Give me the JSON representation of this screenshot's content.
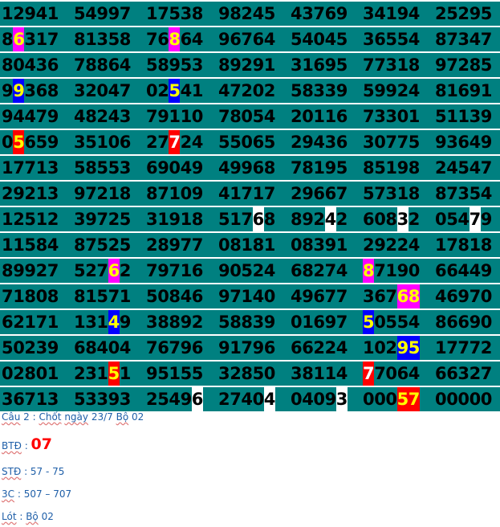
{
  "grid": {
    "rows": [
      [
        "12941",
        "54997",
        "17538",
        "98245",
        "43769",
        "34194",
        "25295"
      ],
      [
        "86317",
        "81358",
        "76864",
        "96764",
        "54045",
        "36554",
        "87347"
      ],
      [
        "80436",
        "78864",
        "58953",
        "89291",
        "31695",
        "77318",
        "97285"
      ],
      [
        "99368",
        "32047",
        "02541",
        "47202",
        "58339",
        "59924",
        "81691"
      ],
      [
        "94479",
        "48243",
        "79110",
        "78054",
        "20116",
        "73301",
        "51139"
      ],
      [
        "05659",
        "35106",
        "27724",
        "55065",
        "29436",
        "30775",
        "93649"
      ],
      [
        "17713",
        "58553",
        "69049",
        "49968",
        "78195",
        "85198",
        "24547"
      ],
      [
        "29213",
        "97218",
        "87109",
        "41717",
        "29667",
        "57318",
        "87354"
      ],
      [
        "12512",
        "39725",
        "31918",
        "51768",
        "89242",
        "60832",
        "05479"
      ],
      [
        "11584",
        "87525",
        "28977",
        "08181",
        "08391",
        "29224",
        "17818"
      ],
      [
        "89927",
        "52762",
        "79716",
        "90524",
        "68274",
        "87190",
        "66449"
      ],
      [
        "71808",
        "81571",
        "50846",
        "97140",
        "49677",
        "36768",
        "46970"
      ],
      [
        "62171",
        "13149",
        "38892",
        "58839",
        "01697",
        "50554",
        "86690"
      ],
      [
        "50239",
        "68404",
        "76796",
        "91796",
        "66224",
        "10295",
        "17772"
      ],
      [
        "02801",
        "23151",
        "95155",
        "32850",
        "38114",
        "77064",
        "66327"
      ],
      [
        "36713",
        "53393",
        "25496",
        "27404",
        "04093",
        "00057",
        "00000"
      ]
    ],
    "highlights": [
      {
        "row": 1,
        "col": 0,
        "digits": [
          1
        ],
        "style": "magenta"
      },
      {
        "row": 1,
        "col": 2,
        "digits": [
          2
        ],
        "style": "magenta"
      },
      {
        "row": 3,
        "col": 0,
        "digits": [
          1
        ],
        "style": "blue"
      },
      {
        "row": 3,
        "col": 2,
        "digits": [
          2
        ],
        "style": "blue"
      },
      {
        "row": 5,
        "col": 0,
        "digits": [
          1
        ],
        "style": "red-yellow"
      },
      {
        "row": 5,
        "col": 2,
        "digits": [
          2
        ],
        "style": "red"
      },
      {
        "row": 8,
        "col": 3,
        "digits": [
          3
        ],
        "style": "white"
      },
      {
        "row": 8,
        "col": 4,
        "digits": [
          3
        ],
        "style": "white"
      },
      {
        "row": 8,
        "col": 5,
        "digits": [
          3
        ],
        "style": "white"
      },
      {
        "row": 8,
        "col": 6,
        "digits": [
          3
        ],
        "style": "white"
      },
      {
        "row": 10,
        "col": 1,
        "digits": [
          3
        ],
        "style": "magenta"
      },
      {
        "row": 10,
        "col": 5,
        "digits": [
          0
        ],
        "style": "magenta"
      },
      {
        "row": 11,
        "col": 5,
        "digits": [
          3,
          4
        ],
        "style": "magenta"
      },
      {
        "row": 12,
        "col": 1,
        "digits": [
          3
        ],
        "style": "blue"
      },
      {
        "row": 12,
        "col": 5,
        "digits": [
          0
        ],
        "style": "blue"
      },
      {
        "row": 13,
        "col": 5,
        "digits": [
          3,
          4
        ],
        "style": "blue"
      },
      {
        "row": 14,
        "col": 1,
        "digits": [
          3
        ],
        "style": "red-yellow"
      },
      {
        "row": 14,
        "col": 5,
        "digits": [
          0
        ],
        "style": "red"
      },
      {
        "row": 15,
        "col": 2,
        "digits": [
          4
        ],
        "style": "white"
      },
      {
        "row": 15,
        "col": 3,
        "digits": [
          4
        ],
        "style": "white"
      },
      {
        "row": 15,
        "col": 4,
        "digits": [
          4
        ],
        "style": "white"
      },
      {
        "row": 15,
        "col": 5,
        "digits": [
          3,
          4
        ],
        "style": "red-yellow"
      }
    ]
  },
  "notes": {
    "line1": {
      "parts": [
        {
          "t": "Câu",
          "u": true
        },
        {
          "t": " 2 : ",
          "u": false
        },
        {
          "t": "Chốt",
          "u": true
        },
        {
          "t": " ",
          "u": false
        },
        {
          "t": "ngày",
          "u": true
        },
        {
          "t": " 23/7 ",
          "u": false
        },
        {
          "t": "Bộ",
          "u": true
        },
        {
          "t": " 02",
          "u": false
        }
      ]
    },
    "line2": {
      "label": "BTĐ",
      "sep": " : ",
      "value": "07"
    },
    "line3": {
      "label": "STĐ",
      "sep": " : ",
      "value": " 57 - 75"
    },
    "line4": {
      "label": "3C",
      "sep": " : ",
      "value": " 507  – 707"
    },
    "line5": {
      "label": "Lót",
      "sep": " : ",
      "value_u": "Bộ",
      "value": " 02"
    }
  },
  "colors": {
    "teal": "#008080",
    "magenta": "#ff00ff",
    "blue": "#0000ff",
    "red": "#ff0000",
    "white": "#ffffff",
    "yellow": "#ffff00",
    "link": "#1f5fa8"
  }
}
